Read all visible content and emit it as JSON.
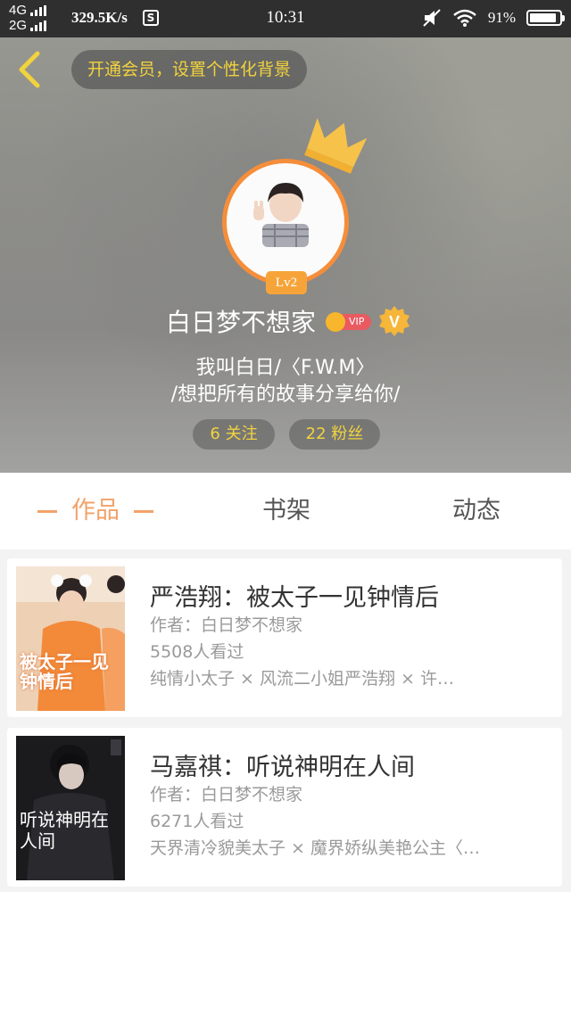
{
  "status_bar": {
    "net1": "4G",
    "net2": "2G",
    "speed": "329.5K/s",
    "s_icon": "S",
    "time": "10:31",
    "battery_pct": "91%",
    "battery_level": 0.91
  },
  "header": {
    "promo": "开通会员，设置个性化背景",
    "level": "Lv2",
    "username": "白日梦不想家",
    "vip_label": "VIP",
    "v_label": "V",
    "bio_line1": "我叫白日/〈F.W.M〉",
    "bio_line2": "/想把所有的故事分享给你/",
    "follow": "6  关注",
    "fans": "22  粉丝"
  },
  "tabs": {
    "works": "作品",
    "shelf": "书架",
    "feed": "动态"
  },
  "works": [
    {
      "title": "严浩翔：被太子一见钟情后",
      "author": "作者：白日梦不想家",
      "views": "5508人看过",
      "desc": "纯情小太子 × 风流二小姐严浩翔 × 许…",
      "cover_text": "被太子一见钟情后"
    },
    {
      "title": "马嘉祺：听说神明在人间",
      "author": "作者：白日梦不想家",
      "views": "6271人看过",
      "desc": "天界清冷貌美太子 × 魔界娇纵美艳公主〈…",
      "cover_text": "听说神明在人间"
    }
  ],
  "colors": {
    "accent": "#f2a26a",
    "gold": "#f2d33d",
    "ring": "#f58e3b"
  }
}
